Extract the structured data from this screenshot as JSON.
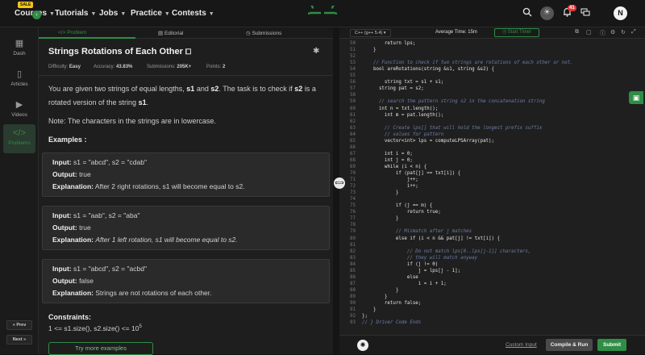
{
  "nav": {
    "sale_badge": "SALE",
    "items": [
      {
        "label": "Courses"
      },
      {
        "label": "Tutorials"
      },
      {
        "label": "Jobs"
      },
      {
        "label": "Practice"
      },
      {
        "label": "Contests"
      }
    ],
    "notification_count": "41",
    "avatar_initial": "N"
  },
  "sidebar": {
    "items": [
      {
        "label": "Dash",
        "icon": "grid-icon"
      },
      {
        "label": "Articles",
        "icon": "book-icon"
      },
      {
        "label": "Videos",
        "icon": "video-icon"
      },
      {
        "label": "Problems",
        "icon": "code-icon",
        "active": true
      }
    ],
    "prev_label": "« Prev",
    "next_label": "Next »"
  },
  "tabs": [
    {
      "label": "Problem",
      "icon": "</>"
    },
    {
      "label": "Editorial",
      "icon": "▤"
    },
    {
      "label": "Submissions",
      "icon": "◷"
    }
  ],
  "problem": {
    "title": "Strings Rotations of Each Other",
    "difficulty_label": "Difficulty:",
    "difficulty": "Easy",
    "accuracy_label": "Accuracy:",
    "accuracy": "43.83%",
    "submissions_label": "Submissions:",
    "submissions": "205K+",
    "points_label": "Points:",
    "points": "2",
    "desc_1": "You are given two strings of equal lengths,",
    "s1": "s1",
    "and_word": "and",
    "s2": "s2",
    "desc_2": ". The task is to check if",
    "desc_3": "is a rotated version of the string",
    "period": ".",
    "note": "Note: The characters in the strings are in lowercase.",
    "examples_heading": "Examples :",
    "input_label": "Input:",
    "output_label": "Output:",
    "explanation_label": "Explanation:",
    "examples": [
      {
        "input": "s1 = \"abcd\", s2 = \"cdab\"",
        "output": "true",
        "explanation": "After 2 right rotations, s1 will become equal to s2."
      },
      {
        "input": "s1 = \"aab\", s2 = \"aba\"",
        "output": "true",
        "explanation": "After 1 left rotation, s1 will become equal to s2."
      },
      {
        "input": "s1 = \"abcd\", s2 = \"acbd\"",
        "output": "false",
        "explanation": "Strings are not rotations of each other."
      }
    ],
    "constraints_heading": "Constraints:",
    "constraint": "1 <= s1.size(), s2.size() <= 10",
    "constraint_exp": "5",
    "try_more": "Try more examples"
  },
  "editor": {
    "language": "C++ (g++ 5.4)",
    "avg_time_label": "Average Time:",
    "avg_time": "15m",
    "timer_label": "Start Timer",
    "lines": [
      {
        "n": "50",
        "code": "        return lps;",
        "comment": false
      },
      {
        "n": "51",
        "code": "    }",
        "comment": false
      },
      {
        "n": "52",
        "code": "",
        "comment": false
      },
      {
        "n": "53",
        "code": "    // Function to check if two strings are rotations of each other or not.",
        "comment": true
      },
      {
        "n": "54",
        "code": "    bool areRotations(string &s1, string &s2) {",
        "comment": false
      },
      {
        "n": "55",
        "code": "",
        "comment": false
      },
      {
        "n": "56",
        "code": "        string txt = s1 + s1;",
        "comment": false
      },
      {
        "n": "57",
        "code": "      string pat = s2;",
        "comment": false
      },
      {
        "n": "58",
        "code": "",
        "comment": false
      },
      {
        "n": "59",
        "code": "      // search the pattern string s2 in the concatenation string",
        "comment": true
      },
      {
        "n": "60",
        "code": "      int n = txt.length();",
        "comment": false
      },
      {
        "n": "61",
        "code": "        int m = pat.length();",
        "comment": false
      },
      {
        "n": "62",
        "code": "",
        "comment": false
      },
      {
        "n": "63",
        "code": "        // Create lps[] that will hold the longest prefix suffix",
        "comment": true
      },
      {
        "n": "64",
        "code": "        // values for pattern",
        "comment": true
      },
      {
        "n": "65",
        "code": "        vector<int> lps = computeLPSArray(pat);",
        "comment": false
      },
      {
        "n": "66",
        "code": "",
        "comment": false
      },
      {
        "n": "67",
        "code": "        int i = 0;",
        "comment": false
      },
      {
        "n": "68",
        "code": "        int j = 0;",
        "comment": false
      },
      {
        "n": "69",
        "code": "        while (i < n) {",
        "comment": false
      },
      {
        "n": "70",
        "code": "            if (pat[j] == txt[i]) {",
        "comment": false
      },
      {
        "n": "71",
        "code": "                j++;",
        "comment": false
      },
      {
        "n": "72",
        "code": "                i++;",
        "comment": false
      },
      {
        "n": "73",
        "code": "            }",
        "comment": false
      },
      {
        "n": "74",
        "code": "",
        "comment": false
      },
      {
        "n": "75",
        "code": "            if (j == m) {",
        "comment": false
      },
      {
        "n": "76",
        "code": "                return true;",
        "comment": false
      },
      {
        "n": "77",
        "code": "            }",
        "comment": false
      },
      {
        "n": "78",
        "code": "",
        "comment": false
      },
      {
        "n": "79",
        "code": "            // Mismatch after j matches",
        "comment": true
      },
      {
        "n": "80",
        "code": "            else if (i < n && pat[j] != txt[i]) {",
        "comment": false
      },
      {
        "n": "81",
        "code": "",
        "comment": false
      },
      {
        "n": "82",
        "code": "                // Do not match lps[0..lps[j-1]] characters,",
        "comment": true
      },
      {
        "n": "83",
        "code": "                // they will match anyway",
        "comment": true
      },
      {
        "n": "84",
        "code": "                if (j != 0)",
        "comment": false
      },
      {
        "n": "85",
        "code": "                    j = lps[j - 1];",
        "comment": false
      },
      {
        "n": "86",
        "code": "                else",
        "comment": false
      },
      {
        "n": "87",
        "code": "                    i = i + 1;",
        "comment": false
      },
      {
        "n": "88",
        "code": "            }",
        "comment": false
      },
      {
        "n": "89",
        "code": "        }",
        "comment": false
      },
      {
        "n": "90",
        "code": "        return false;",
        "comment": false
      },
      {
        "n": "91",
        "code": "    }",
        "comment": false
      },
      {
        "n": "92",
        "code": "};",
        "comment": false
      },
      {
        "n": "93",
        "code": "// } Driver Code Ends",
        "comment": true
      }
    ],
    "custom_input": "Custom Input",
    "compile_run": "Compile & Run",
    "submit": "Submit"
  }
}
